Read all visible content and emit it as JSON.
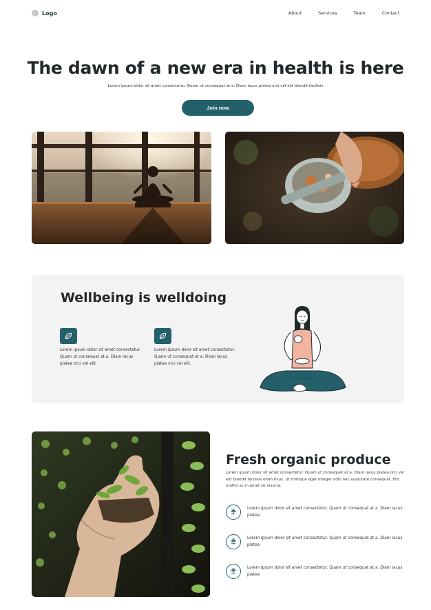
{
  "nav": {
    "logo": "Logo",
    "links": [
      "About",
      "Services",
      "Team",
      "Contact"
    ]
  },
  "hero": {
    "title": "The dawn of a new era in health is here",
    "subtitle": "Lorem ipsum dolor sit amet consectetur. Quam ut consequat at a. Diam lacus platea orci vel elit blandit facilisis",
    "cta_label": "Join now"
  },
  "photos": [
    {
      "subject": "meditation-at-sunset"
    },
    {
      "subject": "mortar-and-pestle-herbs"
    }
  ],
  "wellbeing": {
    "title": "Wellbeing is welldoing",
    "features": [
      {
        "icon": "leaf-icon",
        "text": "Lorem ipsum dolor sit amet consectetur. Quam ut consequat at a. Diam lacus platea orci vel elit."
      },
      {
        "icon": "leaf-icon",
        "text": "Lorem ipsum dolor sit amet consectetur. Quam ut consequat at a. Diam lacus platea orci vel elit."
      }
    ],
    "illustration": "meditating-woman"
  },
  "fresh": {
    "image": "seedlings-in-hand",
    "title": "Fresh organic produce",
    "description": "Lorem ipsum dolor sit amet consectetur. Quam ut consequat at a. Diam lacus platea orci vel elit blandit facilisis enim risus. Ut tristique eget integer odio nec vulputate consequat. Elit mattis ac in amet sit viverra.",
    "items": [
      {
        "icon": "flower-icon",
        "text": "Lorem ipsum dolor sit amet consectetur. Quam ut consequat at a. Diam lacus platea"
      },
      {
        "icon": "flower-icon",
        "text": "Lorem ipsum dolor sit amet consectetur. Quam ut consequat at a. Diam lacus platea"
      },
      {
        "icon": "flower-icon",
        "text": "Lorem ipsum dolor sit amet consectetur. Quam ut consequat at a. Diam lacus platea"
      }
    ]
  },
  "colors": {
    "accent": "#24606a",
    "card_bg": "#f3f3f3",
    "heading": "#23282b"
  }
}
